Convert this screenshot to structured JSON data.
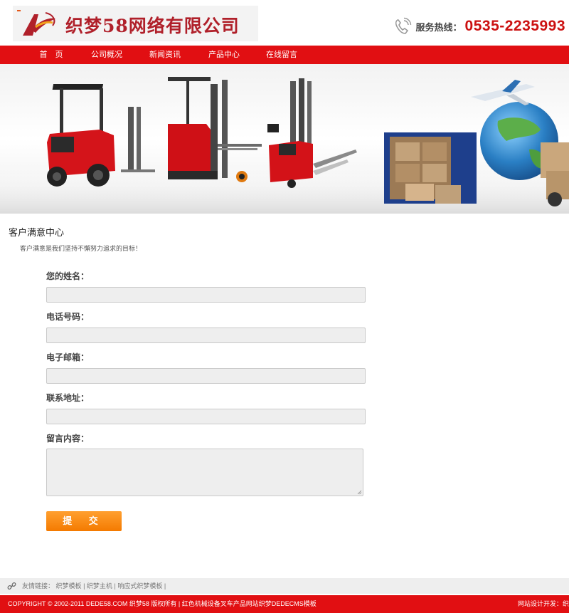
{
  "header": {
    "logo_text": "织梦58网络有限公司",
    "hotline_label": "服务热线：",
    "hotline_number": "0535-2235993"
  },
  "nav": {
    "items": [
      {
        "label": "首　页"
      },
      {
        "label": "公司概况"
      },
      {
        "label": "新闻资讯"
      },
      {
        "label": "产品中心"
      },
      {
        "label": "在线留言"
      }
    ]
  },
  "page": {
    "title": "客户满意中心",
    "subtitle": "客户满意是我们坚持不懈努力追求的目标！"
  },
  "form": {
    "name_label": "您的姓名：",
    "phone_label": "电话号码：",
    "email_label": "电子邮箱：",
    "address_label": "联系地址：",
    "message_label": "留言内容：",
    "name_value": "",
    "phone_value": "",
    "email_value": "",
    "address_value": "",
    "message_value": "",
    "submit_label": "提 交"
  },
  "links": {
    "prefix": "友情链接：",
    "items": [
      {
        "label": "织梦模板"
      },
      {
        "label": "织梦主机"
      },
      {
        "label": "响应式织梦模板"
      }
    ],
    "separator": "|"
  },
  "footer": {
    "copyright": "COPYRIGHT © 2002-2011 DEDE58.COM 织梦58 版权所有 | 红色机械设备叉车产品网站织梦DEDECMS模板",
    "designer": "网站设计开发：织"
  },
  "colors": {
    "brand_red": "#e10f12",
    "logo_red": "#b0202a",
    "submit_orange": "#f47a00",
    "input_bg": "#eeeeee"
  }
}
